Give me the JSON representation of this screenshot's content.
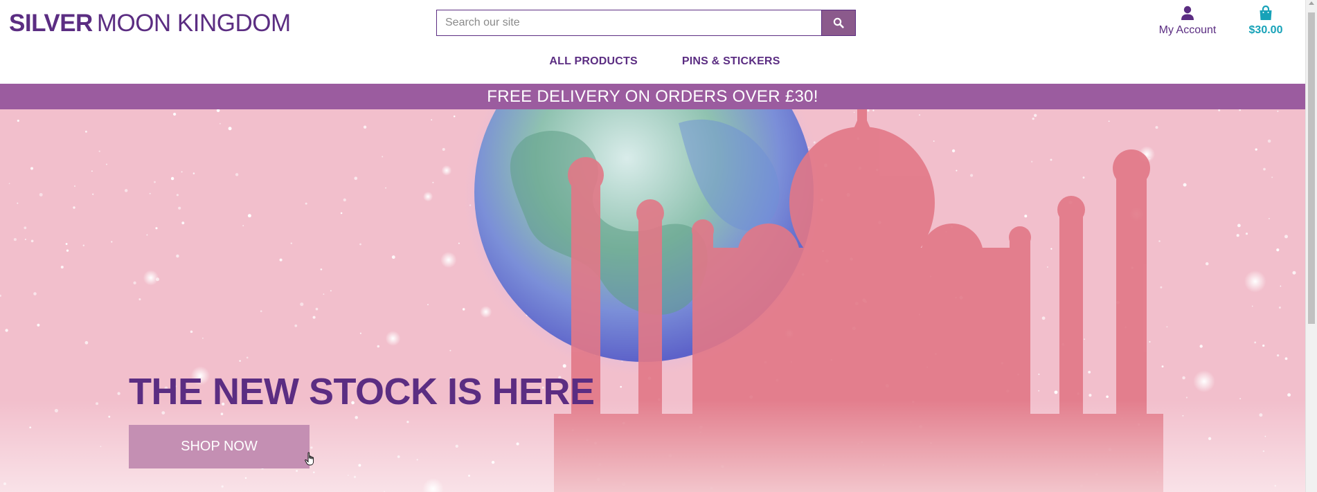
{
  "header": {
    "logo_bold": "SILVER",
    "logo_rest": "MOON KINGDOM",
    "search": {
      "placeholder": "Search our site",
      "button_icon": "search-icon"
    },
    "account": {
      "label": "My Account",
      "icon": "user-icon"
    },
    "cart": {
      "total": "$30.00",
      "icon": "shopping-bag-icon"
    }
  },
  "nav": {
    "items": [
      {
        "label": "ALL PRODUCTS"
      },
      {
        "label": "PINS & STICKERS"
      }
    ]
  },
  "promo": {
    "text": "FREE DELIVERY ON ORDERS OVER £30!"
  },
  "hero": {
    "title": "THE NEW STOCK IS HERE",
    "button_label": "SHOP NOW"
  },
  "colors": {
    "brand_purple": "#5b2d82",
    "promo_bg": "#9b5c9f",
    "cart_teal": "#17a2b8",
    "hero_pink": "#f2bfcc",
    "button_mauve": "#c48fb3"
  }
}
